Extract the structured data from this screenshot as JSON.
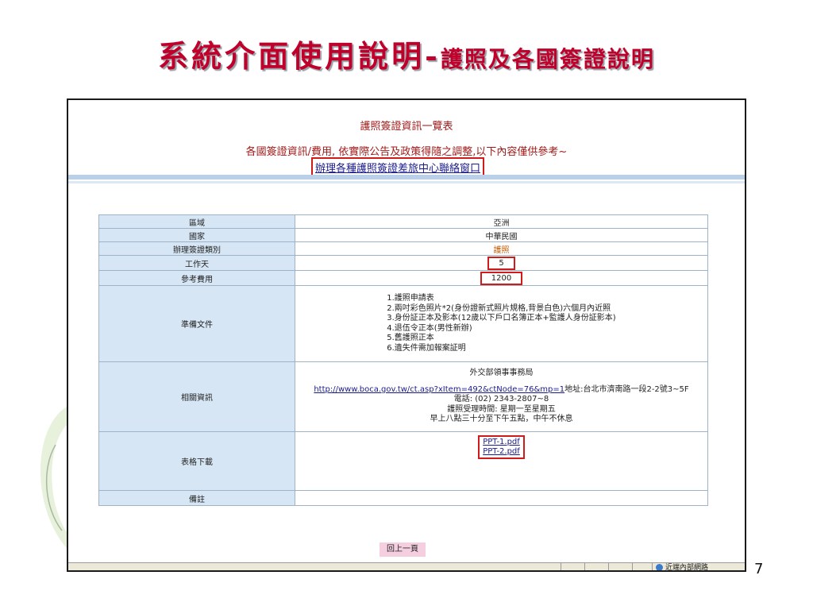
{
  "slide": {
    "title_main": "系統介面使用說明-",
    "title_sub": "護照及各國簽證說明",
    "page_number": "7"
  },
  "page": {
    "list_title": "護照簽證資訊一覽表",
    "notice": "各國簽證資訊/費用, 依實際公告及政策得隨之調整,以下內容僅供參考~",
    "contact_link": "辦理各種護照簽證差旅中心聯絡窗口"
  },
  "table": {
    "region_label": "區域",
    "region_value": "亞洲",
    "country_label": "國家",
    "country_value": "中華民國",
    "type_label": "辦理簽證類別",
    "type_value": "護照",
    "workdays_label": "工作天",
    "workdays_value": "5",
    "fee_label": "參考費用",
    "fee_value": "1200",
    "docs_label": "準備文件",
    "docs": [
      "1.護照申請表",
      "2.兩吋彩色照片*2(身份證新式照片規格,背景白色)六個月內近照",
      "3.身份証正本及影本(12歲以下戶口名簿正本+監護人身份証影本)",
      "4.退伍令正本(男性新辦)",
      "5.舊護照正本",
      "6.遺失件需加報案証明"
    ],
    "related_label": "相關資訊",
    "related_org": "外交部領事事務局",
    "related_url": "http://www.boca.gov.tw/ct.asp?xItem=492&ctNode=76&mp=1",
    "related_address": "地址:台北市濟南路一段2-2號3~5F",
    "related_phone": "電話: (02) 2343-2807~8",
    "related_hours1": "護照受理時間: 星期一至星期五",
    "related_hours2": "早上八點三十分至下午五點，中午不休息",
    "download_label": "表格下載",
    "file1": "PPT-1.pdf",
    "file2": "PPT-2.pdf",
    "remark_label": "備註",
    "remark_value": ""
  },
  "footer": {
    "back_button": "回上一頁",
    "zone_label": "近端內部網路"
  },
  "colors": {
    "title_red": "#c0002a",
    "highlight_red": "#d11a1a",
    "table_key_bg": "#d6e6f5",
    "band_blue": "#b9d0e8"
  }
}
